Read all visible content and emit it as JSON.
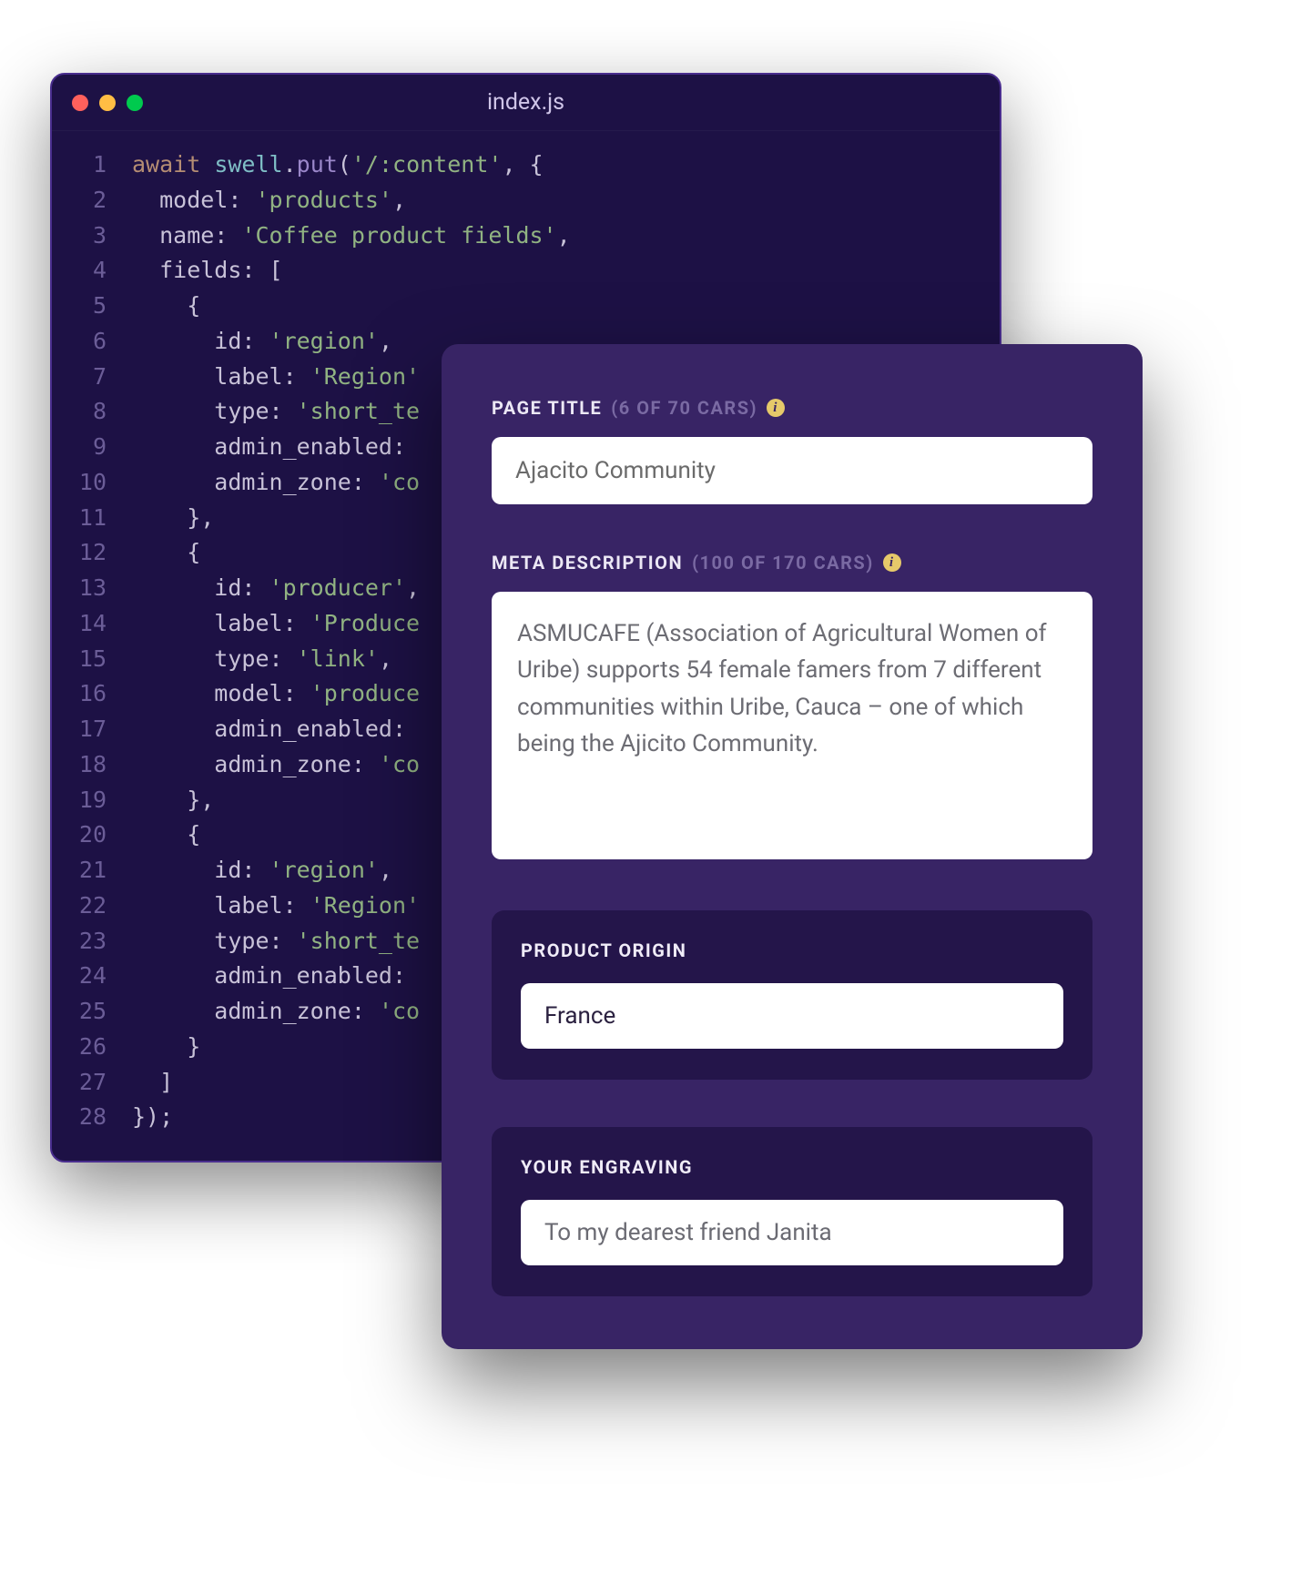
{
  "editor": {
    "filename": "index.js",
    "dots": [
      "red",
      "yellow",
      "green"
    ],
    "lines": [
      [
        {
          "t": "await ",
          "c": "tok-kw"
        },
        {
          "t": "swell",
          "c": "tok-obj"
        },
        {
          "t": ".",
          "c": "tok-punc"
        },
        {
          "t": "put",
          "c": "tok-fn"
        },
        {
          "t": "(",
          "c": "tok-punc"
        },
        {
          "t": "'/:content'",
          "c": "tok-str"
        },
        {
          "t": ", {",
          "c": "tok-punc"
        }
      ],
      [
        {
          "t": "  model: ",
          "c": "tok-prop"
        },
        {
          "t": "'products'",
          "c": "tok-str"
        },
        {
          "t": ",",
          "c": "tok-punc"
        }
      ],
      [
        {
          "t": "  name: ",
          "c": "tok-prop"
        },
        {
          "t": "'Coffee product fields'",
          "c": "tok-str"
        },
        {
          "t": ",",
          "c": "tok-punc"
        }
      ],
      [
        {
          "t": "  fields: [",
          "c": "tok-prop"
        }
      ],
      [
        {
          "t": "    {",
          "c": "tok-punc"
        }
      ],
      [
        {
          "t": "      id: ",
          "c": "tok-prop"
        },
        {
          "t": "'region'",
          "c": "tok-str"
        },
        {
          "t": ",",
          "c": "tok-punc"
        }
      ],
      [
        {
          "t": "      label: ",
          "c": "tok-prop"
        },
        {
          "t": "'Region'",
          "c": "tok-str"
        }
      ],
      [
        {
          "t": "      type: ",
          "c": "tok-prop"
        },
        {
          "t": "'short_te",
          "c": "tok-str"
        }
      ],
      [
        {
          "t": "      admin_enabled: ",
          "c": "tok-prop"
        }
      ],
      [
        {
          "t": "      admin_zone: ",
          "c": "tok-prop"
        },
        {
          "t": "'co",
          "c": "tok-str"
        }
      ],
      [
        {
          "t": "    },",
          "c": "tok-punc"
        }
      ],
      [
        {
          "t": "    {",
          "c": "tok-punc"
        }
      ],
      [
        {
          "t": "      id: ",
          "c": "tok-prop"
        },
        {
          "t": "'producer'",
          "c": "tok-str"
        },
        {
          "t": ",",
          "c": "tok-punc"
        }
      ],
      [
        {
          "t": "      label: ",
          "c": "tok-prop"
        },
        {
          "t": "'Produce",
          "c": "tok-str"
        }
      ],
      [
        {
          "t": "      type: ",
          "c": "tok-prop"
        },
        {
          "t": "'link'",
          "c": "tok-str"
        },
        {
          "t": ",",
          "c": "tok-punc"
        }
      ],
      [
        {
          "t": "      model: ",
          "c": "tok-prop"
        },
        {
          "t": "'produce",
          "c": "tok-str"
        }
      ],
      [
        {
          "t": "      admin_enabled: ",
          "c": "tok-prop"
        }
      ],
      [
        {
          "t": "      admin_zone: ",
          "c": "tok-prop"
        },
        {
          "t": "'co",
          "c": "tok-str"
        }
      ],
      [
        {
          "t": "    },",
          "c": "tok-punc"
        }
      ],
      [
        {
          "t": "    {",
          "c": "tok-punc"
        }
      ],
      [
        {
          "t": "      id: ",
          "c": "tok-prop"
        },
        {
          "t": "'region'",
          "c": "tok-str"
        },
        {
          "t": ",",
          "c": "tok-punc"
        }
      ],
      [
        {
          "t": "      label: ",
          "c": "tok-prop"
        },
        {
          "t": "'Region'",
          "c": "tok-str"
        }
      ],
      [
        {
          "t": "      type: ",
          "c": "tok-prop"
        },
        {
          "t": "'short_te",
          "c": "tok-str"
        }
      ],
      [
        {
          "t": "      admin_enabled: ",
          "c": "tok-prop"
        }
      ],
      [
        {
          "t": "      admin_zone: ",
          "c": "tok-prop"
        },
        {
          "t": "'co",
          "c": "tok-str"
        }
      ],
      [
        {
          "t": "    }",
          "c": "tok-punc"
        }
      ],
      [
        {
          "t": "  ]",
          "c": "tok-punc"
        }
      ],
      [
        {
          "t": "});",
          "c": "tok-punc"
        }
      ]
    ]
  },
  "form": {
    "pageTitle": {
      "label": "PAGE TITLE",
      "hint": "(6 OF 70 CARS)",
      "value": "Ajacito Community"
    },
    "metaDescription": {
      "label": "META DESCRIPTION",
      "hint": "(100 OF 170 CARS)",
      "value": "ASMUCAFE (Association of Agricultural Women of Uribe) supports 54 female famers from 7 different communities within Uribe, Cauca – one of which being the Ajicito Community."
    },
    "productOrigin": {
      "label": "PRODUCT ORIGIN",
      "value": "France"
    },
    "engraving": {
      "label": "YOUR ENGRAVING",
      "value": "To my dearest friend Janita"
    }
  }
}
